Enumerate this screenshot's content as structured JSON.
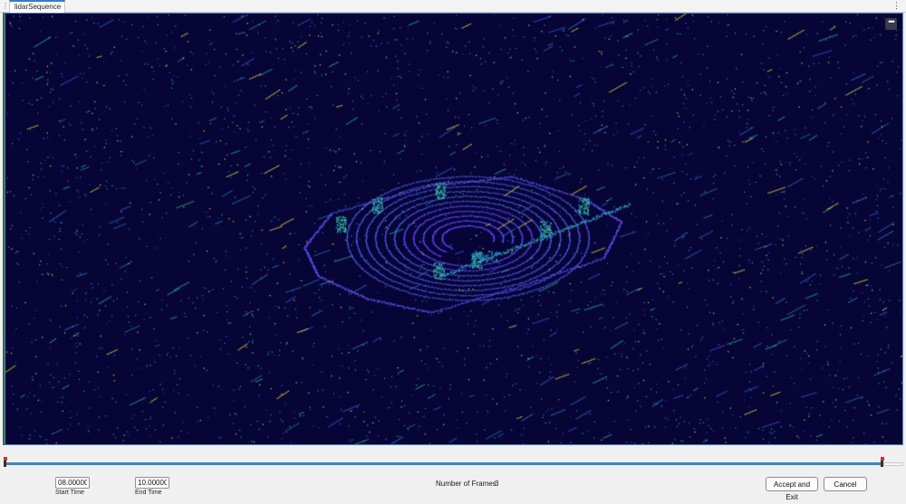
{
  "tab": {
    "title": "lidarSequence",
    "menu_icon": "vertical-ellipsis-icon"
  },
  "viewer": {
    "more_icon_text": "•••"
  },
  "controls": {
    "start_time_value": "08.0000C",
    "start_time_label": "Start Time",
    "end_time_value": "10.0000C",
    "end_time_label": "End Time",
    "frames_label": "Number of Frames",
    "frames_value": "3"
  },
  "buttons": {
    "accept": "Accept and Exit",
    "cancel": "Cancel"
  },
  "colors": {
    "background": "#060536",
    "near": "#5a3df0",
    "mid": "#2f7ec8",
    "far": "#1fb39a",
    "high": "#e3d830",
    "accent": "#3c86c6"
  }
}
